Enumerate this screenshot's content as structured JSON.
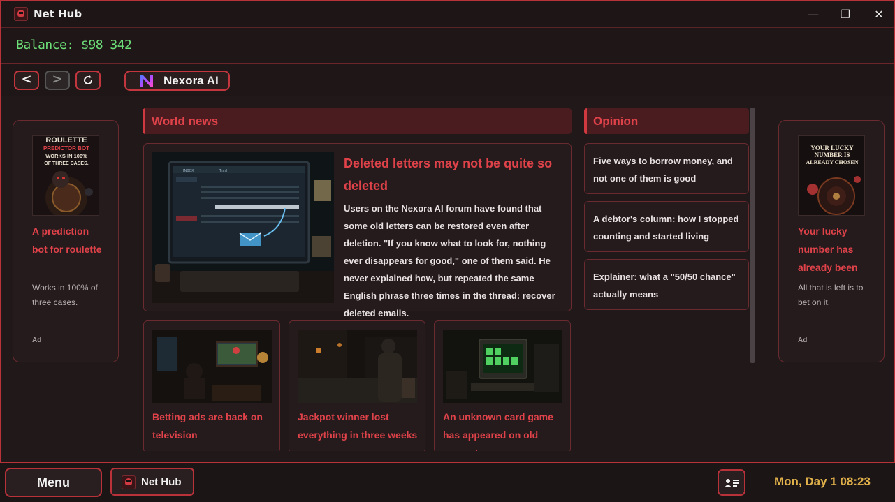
{
  "window": {
    "title": "Net Hub",
    "controls": {
      "minimize": "—",
      "maximize": "❐",
      "close": "✕"
    }
  },
  "balance": "Balance: $98 342",
  "nav": {
    "back": "<",
    "forward": ">",
    "tab_label": "Nexora AI"
  },
  "ads": [
    {
      "image_text": [
        "ROULETTE",
        "PREDICTOR BOT",
        "WORKS IN 100%",
        "OF THREE CASES."
      ],
      "title": "A prediction bot for roulette",
      "description": "Works in 100% of three cases.",
      "tag": "Ad"
    },
    {
      "image_text": [
        "YOUR LUCKY",
        "NUMBER IS",
        "ALREADY CHOSEN"
      ],
      "title": "Your lucky number has already been",
      "description": "All that is left is to bet on it.",
      "tag": "Ad"
    }
  ],
  "world_news": {
    "header": "World news",
    "feature": {
      "title": "Deleted letters may not be quite so deleted",
      "text": "Users on the Nexora AI forum have found that some old letters can be restored even after deletion. \"If you know what to look for, nothing ever disappears for good,\" one of them said. He never explained how, but repeated the same English phrase three times in the thread: recover deleted emails.",
      "image_labels": {
        "inbox": "INBOX",
        "trash": "Trash"
      }
    },
    "cards": [
      {
        "title": "Betting ads are back on television"
      },
      {
        "title": "Jackpot winner lost everything in three weeks"
      },
      {
        "title": "An unknown card game has appeared on old computers"
      }
    ]
  },
  "opinion": {
    "header": "Opinion",
    "items": [
      {
        "title": "Five ways to borrow money, and not one of them is good"
      },
      {
        "title": "A debtor's column: how I stopped counting and started living"
      },
      {
        "title": "Explainer: what a \"50/50 chance\" actually means"
      }
    ]
  },
  "taskbar": {
    "menu_label": "Menu",
    "app_label": "Net Hub",
    "datetime": "Mon, Day 1  08:23"
  },
  "colors": {
    "accent": "#c3363e",
    "headline": "#e0424a",
    "balance": "#6ee07a",
    "clock": "#e0b04a"
  }
}
